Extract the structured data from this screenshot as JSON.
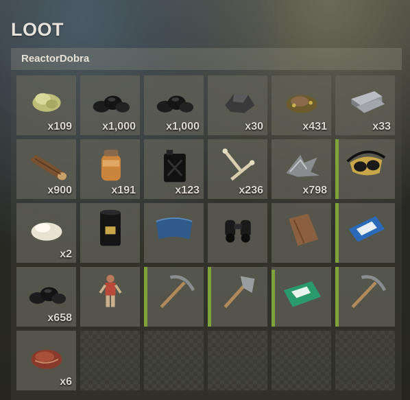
{
  "loot": {
    "title": "LOOT",
    "container_name": "ReactorDobra",
    "rows": [
      [
        {
          "name": "sulfur-ore-icon",
          "qty": "x109"
        },
        {
          "name": "coal-icon",
          "qty": "x1,000"
        },
        {
          "name": "coal-icon",
          "qty": "x1,000"
        },
        {
          "name": "metal-ore-icon",
          "qty": "x30"
        },
        {
          "name": "hq-metal-ore-icon",
          "qty": "x431"
        },
        {
          "name": "hq-metal-ingot-icon",
          "qty": "x33"
        }
      ],
      [
        {
          "name": "wood-log-icon",
          "qty": "x900"
        },
        {
          "name": "jar-icon",
          "qty": "x191"
        },
        {
          "name": "jerrycan-icon",
          "qty": "x123"
        },
        {
          "name": "bone-fragments-icon",
          "qty": "x236"
        },
        {
          "name": "metal-fragments-icon",
          "qty": "x798"
        },
        {
          "name": "diving-mask-icon",
          "qty": "",
          "condition": 1.0
        }
      ],
      [
        {
          "name": "cloth-icon",
          "qty": "x2"
        },
        {
          "name": "oil-barrel-icon",
          "qty": ""
        },
        {
          "name": "tarp-icon",
          "qty": ""
        },
        {
          "name": "binoculars-icon",
          "qty": ""
        },
        {
          "name": "wooden-plank-icon",
          "qty": ""
        },
        {
          "name": "blue-keycard-icon",
          "qty": "",
          "condition": 1.0
        }
      ],
      [
        {
          "name": "coal-icon",
          "qty": "x658"
        },
        {
          "name": "figurine-icon",
          "qty": ""
        },
        {
          "name": "pickaxe-icon",
          "qty": "",
          "condition": 1.0
        },
        {
          "name": "hatchet-icon",
          "qty": "",
          "condition": 1.0
        },
        {
          "name": "green-keycard-icon",
          "qty": "",
          "condition": 0.95
        },
        {
          "name": "pickaxe-icon",
          "qty": "",
          "condition": 1.0
        }
      ],
      [
        {
          "name": "raw-meat-icon",
          "qty": "x6"
        },
        {
          "name": "empty",
          "qty": ""
        },
        {
          "name": "empty",
          "qty": ""
        },
        {
          "name": "empty",
          "qty": ""
        },
        {
          "name": "empty",
          "qty": ""
        },
        {
          "name": "empty",
          "qty": ""
        }
      ]
    ]
  }
}
